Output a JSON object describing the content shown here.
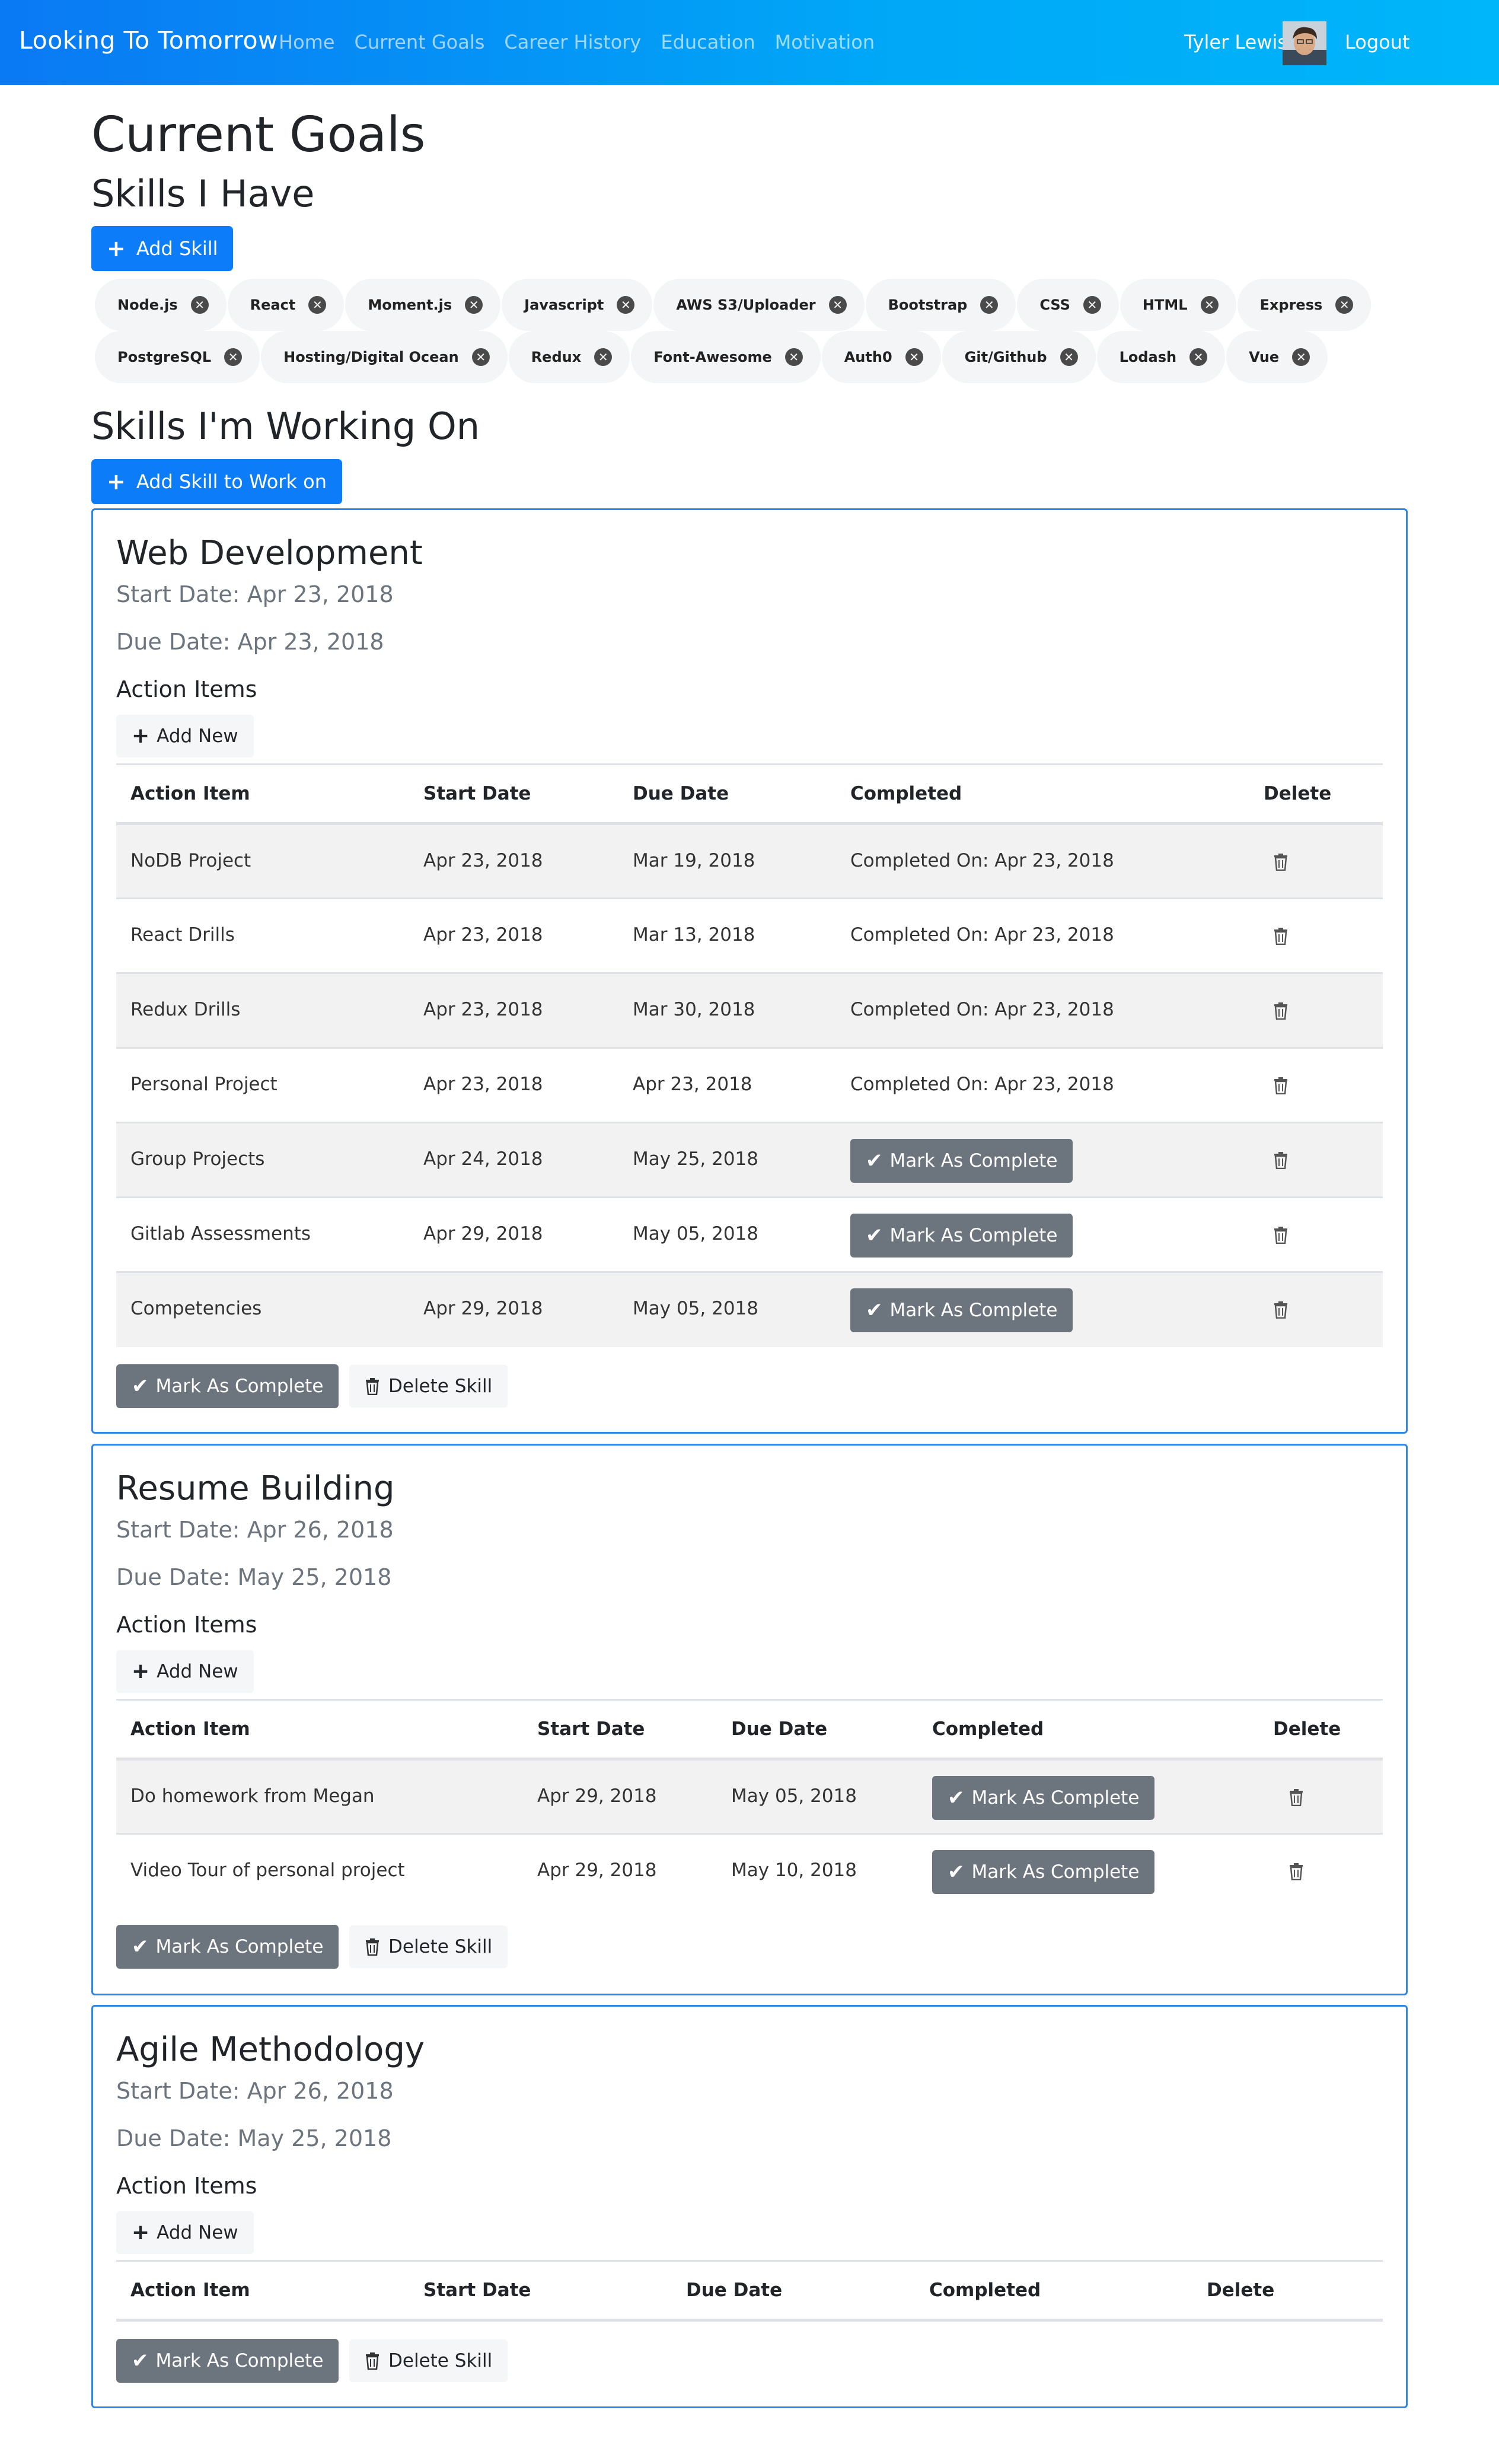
{
  "nav": {
    "brand": "Looking To Tomorrow",
    "links": [
      "Home",
      "Current Goals",
      "Career History",
      "Education",
      "Motivation"
    ],
    "user": "Tyler Lewis",
    "logout": "Logout"
  },
  "page": {
    "title": "Current Goals",
    "skills_have_heading": "Skills I Have",
    "add_skill": "Add Skill",
    "skills_working_heading": "Skills I'm Working On",
    "add_skill_work": "Add Skill to Work on"
  },
  "skills": [
    "Node.js",
    "React",
    "Moment.js",
    "Javascript",
    "AWS S3/Uploader",
    "Bootstrap",
    "CSS",
    "HTML",
    "Express",
    "PostgreSQL",
    "Hosting/Digital Ocean",
    "Redux",
    "Font-Awesome",
    "Auth0",
    "Git/Github",
    "Lodash",
    "Vue"
  ],
  "labels": {
    "action_items": "Action Items",
    "add_new": "Add New",
    "mark_complete": "Mark As Complete",
    "delete_skill": "Delete Skill",
    "columns": [
      "Action Item",
      "Start Date",
      "Due Date",
      "Completed",
      "Delete"
    ]
  },
  "cards": [
    {
      "title": "Web Development",
      "start": "Start Date: Apr 23, 2018",
      "due": "Due Date: Apr 23, 2018",
      "items": [
        {
          "name": "NoDB Project",
          "start": "Apr 23, 2018",
          "due": "Mar 19, 2018",
          "completed": "Completed On: Apr 23, 2018"
        },
        {
          "name": "React Drills",
          "start": "Apr 23, 2018",
          "due": "Mar 13, 2018",
          "completed": "Completed On: Apr 23, 2018"
        },
        {
          "name": "Redux Drills",
          "start": "Apr 23, 2018",
          "due": "Mar 30, 2018",
          "completed": "Completed On: Apr 23, 2018"
        },
        {
          "name": "Personal Project",
          "start": "Apr 23, 2018",
          "due": "Apr 23, 2018",
          "completed": "Completed On: Apr 23, 2018"
        },
        {
          "name": "Group Projects",
          "start": "Apr 24, 2018",
          "due": "May 25, 2018",
          "completed": ""
        },
        {
          "name": "Gitlab Assessments",
          "start": "Apr 29, 2018",
          "due": "May 05, 2018",
          "completed": ""
        },
        {
          "name": "Competencies",
          "start": "Apr 29, 2018",
          "due": "May 05, 2018",
          "completed": ""
        }
      ]
    },
    {
      "title": "Resume Building",
      "start": "Start Date: Apr 26, 2018",
      "due": "Due Date: May 25, 2018",
      "items": [
        {
          "name": "Do homework from Megan",
          "start": "Apr 29, 2018",
          "due": "May 05, 2018",
          "completed": ""
        },
        {
          "name": "Video Tour of personal project",
          "start": "Apr 29, 2018",
          "due": "May 10, 2018",
          "completed": ""
        }
      ]
    },
    {
      "title": "Agile Methodology",
      "start": "Start Date: Apr 26, 2018",
      "due": "Due Date: May 25, 2018",
      "items": []
    }
  ]
}
